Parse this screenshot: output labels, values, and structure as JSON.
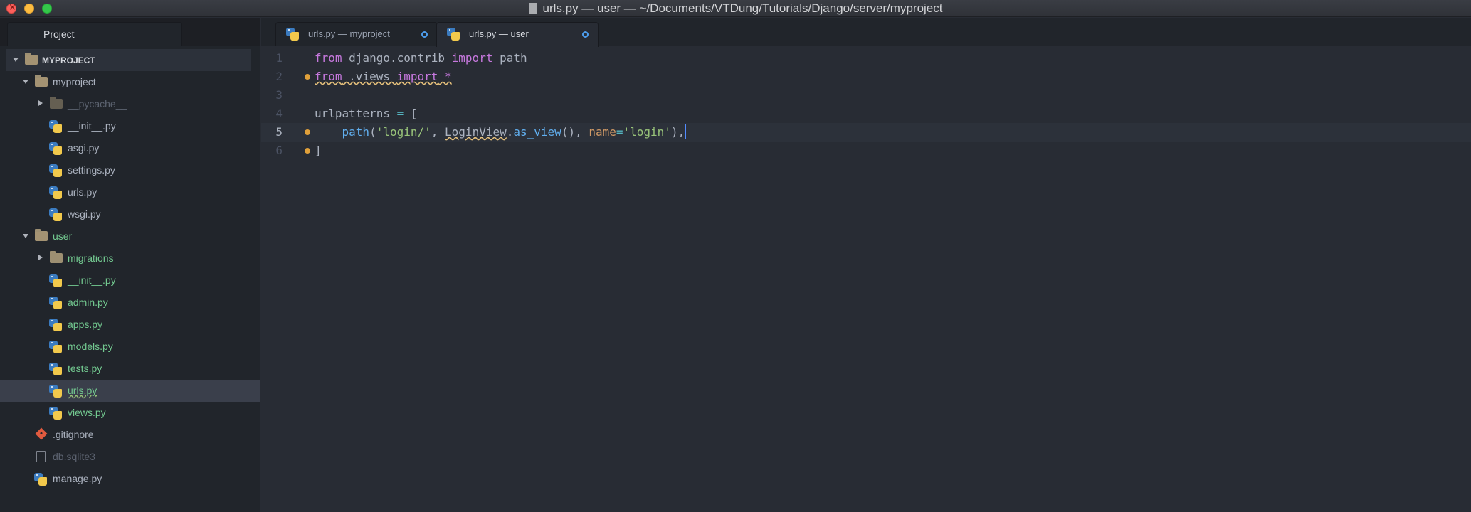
{
  "window": {
    "title": "urls.py — user — ~/Documents/VTDung/Tutorials/Django/server/myproject"
  },
  "sidebar": {
    "panel_title": "Project",
    "tree": [
      {
        "label": "MYPROJECT",
        "type": "root",
        "expanded": true
      },
      {
        "label": "myproject",
        "type": "folder",
        "expanded": true
      },
      {
        "label": "__pycache__",
        "type": "folder",
        "expanded": false,
        "ignored": true
      },
      {
        "label": "__init__.py",
        "type": "py"
      },
      {
        "label": "asgi.py",
        "type": "py"
      },
      {
        "label": "settings.py",
        "type": "py"
      },
      {
        "label": "urls.py",
        "type": "py"
      },
      {
        "label": "wsgi.py",
        "type": "py"
      },
      {
        "label": "user",
        "type": "folder",
        "expanded": true,
        "status": "new"
      },
      {
        "label": "migrations",
        "type": "folder",
        "expanded": false,
        "status": "new"
      },
      {
        "label": "__init__.py",
        "type": "py",
        "status": "new"
      },
      {
        "label": "admin.py",
        "type": "py",
        "status": "new"
      },
      {
        "label": "apps.py",
        "type": "py",
        "status": "new"
      },
      {
        "label": "models.py",
        "type": "py",
        "status": "new"
      },
      {
        "label": "tests.py",
        "type": "py",
        "status": "new"
      },
      {
        "label": "urls.py",
        "type": "py",
        "status": "new",
        "selected": true
      },
      {
        "label": "views.py",
        "type": "py",
        "status": "new"
      },
      {
        "label": ".gitignore",
        "type": "git"
      },
      {
        "label": "db.sqlite3",
        "type": "file",
        "ignored": true
      },
      {
        "label": "manage.py",
        "type": "py"
      }
    ]
  },
  "tabs": [
    {
      "label": "urls.py — myproject",
      "active": false,
      "modified": true
    },
    {
      "label": "urls.py — user",
      "active": true,
      "modified": true
    }
  ],
  "editor": {
    "line_numbers": [
      "1",
      "2",
      "3",
      "4",
      "5",
      "6"
    ],
    "line1": {
      "t1": "from",
      "t2": " django.contrib ",
      "t3": "import",
      "t4": " path"
    },
    "line2": {
      "t1": "from",
      "t2": " .views ",
      "t3": "import",
      "t4": " *"
    },
    "line4": {
      "t1": "urlpatterns ",
      "t2": "=",
      "t3": " ["
    },
    "line5": {
      "t0": "    ",
      "t1": "path",
      "t2": "(",
      "t3": "'login/'",
      "t4": ", ",
      "t5": "LoginView",
      "t6": ".",
      "t7": "as_view",
      "t8": "(), ",
      "t9": "name",
      "t10": "=",
      "t11": "'login'",
      "t12": "),"
    },
    "line6": {
      "t1": "]"
    }
  },
  "colors": {
    "editor_bg": "#282c34",
    "sidebar_bg": "#21252b",
    "keyword": "#c678dd",
    "string": "#98c379",
    "function": "#61afef",
    "untracked": "#73c990",
    "modified_dot": "#e0a03a"
  }
}
